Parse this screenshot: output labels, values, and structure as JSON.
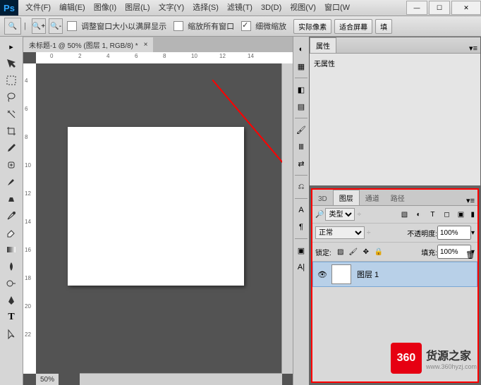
{
  "app": {
    "logo": "Ps"
  },
  "menu": [
    "文件(F)",
    "编辑(E)",
    "图像(I)",
    "图层(L)",
    "文字(Y)",
    "选择(S)",
    "滤镜(T)",
    "3D(D)",
    "视图(V)",
    "窗口(W"
  ],
  "options": {
    "chk1": "调整窗口大小以满屏显示",
    "chk2": "缩放所有窗口",
    "chk3": "细微缩放",
    "btn1": "实际像素",
    "btn2": "适合屏幕",
    "btn3": "填"
  },
  "document": {
    "tab": "未标题-1 @ 50% (图层 1, RGB/8) *",
    "zoom": "50%",
    "ruler_h": [
      "0",
      "2",
      "4",
      "6",
      "8",
      "10",
      "12",
      "14"
    ],
    "ruler_v": [
      "4",
      "6",
      "8",
      "10",
      "12",
      "14",
      "16",
      "18",
      "20",
      "22"
    ]
  },
  "panels": {
    "props_tab": "属性",
    "props_text": "无属性",
    "layer_tabs": [
      "3D",
      "图层",
      "通道",
      "路径"
    ],
    "filter_label": "类型",
    "filter_options": [
      "类型"
    ],
    "blend_label": "正常",
    "blend_options": [
      "正常"
    ],
    "opacity_label": "不透明度:",
    "opacity_value": "100%",
    "lock_label": "锁定:",
    "fill_label": "填充:",
    "fill_value": "100%",
    "layer1_name": "图层 1"
  },
  "watermark": {
    "badge": "360",
    "line1": "货源之家",
    "line2": "www.360hyzj.com"
  }
}
